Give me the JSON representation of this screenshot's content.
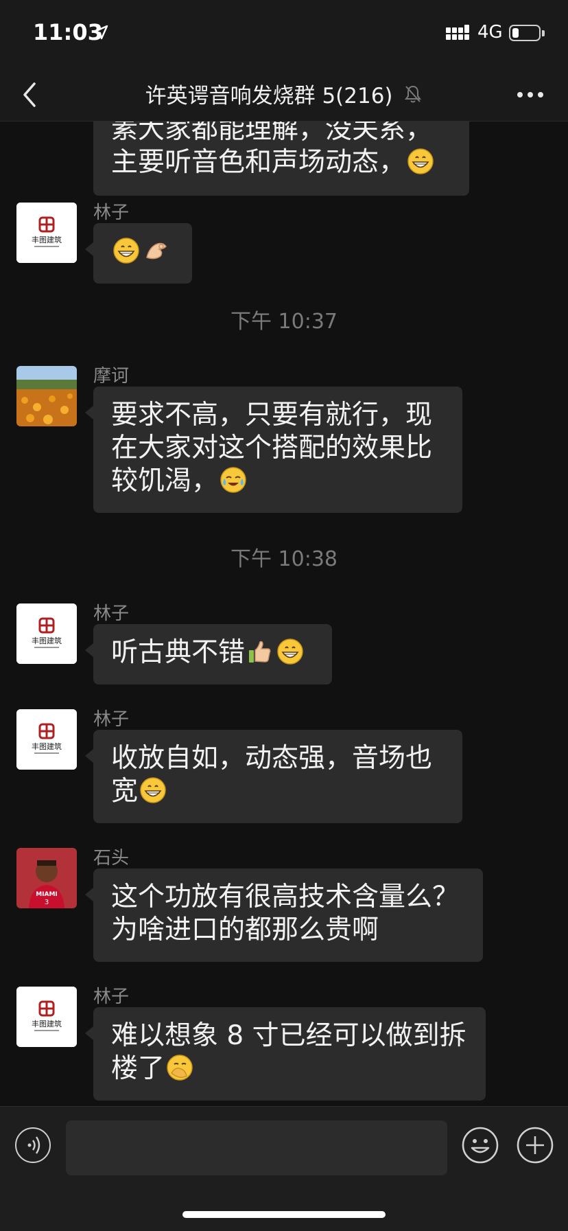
{
  "status": {
    "time": "11:03",
    "network": "4G",
    "battery_level": 0.25
  },
  "nav": {
    "title": "许英谔音响发烧群 5(216)"
  },
  "messages": [
    {
      "type": "msg",
      "sender": "",
      "text": "素大家都能理解，没关系，\n主要听音色和声场动态，",
      "emojis": [
        "grin"
      ],
      "avatar": "none"
    },
    {
      "type": "msg",
      "sender": "林子",
      "text": "",
      "emojis": [
        "grin",
        "ok"
      ],
      "avatar": "logo"
    },
    {
      "type": "time",
      "text": "下午 10:37"
    },
    {
      "type": "msg",
      "sender": "摩诃",
      "text": "要求不高，只要有就行，现\n在大家对这个搭配的效果比\n较饥渴，",
      "emojis": [
        "cry"
      ],
      "avatar": "field"
    },
    {
      "type": "time",
      "text": "下午 10:38"
    },
    {
      "type": "msg",
      "sender": "林子",
      "text": "听古典不错",
      "emojis": [
        "thumb",
        "grin"
      ],
      "avatar": "logo"
    },
    {
      "type": "msg",
      "sender": "林子",
      "text": "收放自如，动态强，音场也\n宽",
      "emojis": [
        "grin"
      ],
      "avatar": "logo"
    },
    {
      "type": "msg",
      "sender": "石头",
      "text": "这个功放有很高技术含量么？\n为啥进口的都那么贵啊",
      "emojis": [],
      "avatar": "player"
    },
    {
      "type": "msg",
      "sender": "林子",
      "text": "难以想象 8 寸已经可以做到拆\n楼了",
      "emojis": [
        "facepalm"
      ],
      "avatar": "logo"
    }
  ],
  "avatars": {
    "logo_text": "丰图建筑",
    "player_jersey_text": "MIAMI",
    "player_jersey_number": "3"
  },
  "colors": {
    "background": "#111111",
    "bubble": "#2c2c2c",
    "bar": "#1a1a1a"
  }
}
